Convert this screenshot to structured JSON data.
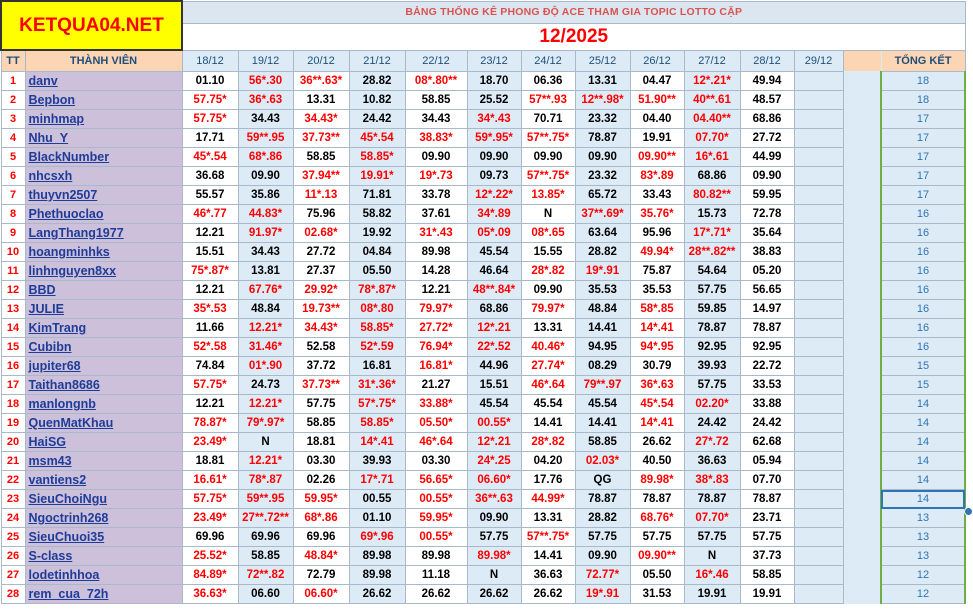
{
  "logo": "KETQUA04.NET",
  "banner_title": "BẢNG THỐNG KÊ PHONG ĐỘ ACE THAM GIA TOPIC  LOTTO CẶP",
  "banner_month": "12/2025",
  "headers": {
    "tt": "TT",
    "member": "THÀNH VIÊN",
    "dates": [
      "18/12",
      "19/12",
      "20/12",
      "21/12",
      "22/12",
      "23/12",
      "24/12",
      "25/12",
      "26/12",
      "27/12",
      "28/12",
      "29/12"
    ],
    "total": "TỔNG KẾT"
  },
  "rows": [
    {
      "tt": "1",
      "name": "danv",
      "total": "18",
      "cells": [
        "01.10",
        "56*.30",
        "36**.63*",
        "28.82",
        "08*.80**",
        "18.70",
        "06.36",
        "13.31",
        "04.47",
        "12*.21*",
        "49.94",
        ""
      ]
    },
    {
      "tt": "2",
      "name": "Bepbon",
      "total": "18",
      "cells": [
        "57.75*",
        "36*.63",
        "13.31",
        "10.82",
        "58.85",
        "25.52",
        "57**.93",
        "12**.98*",
        "51.90**",
        "40**.61",
        "48.57",
        ""
      ]
    },
    {
      "tt": "3",
      "name": "minhmap",
      "total": "17",
      "cells": [
        "57.75*",
        "34.43",
        "34.43*",
        "24.42",
        "34.43",
        "34*.43",
        "70.71",
        "23.32",
        "04.40",
        "04.40**",
        "68.86",
        ""
      ]
    },
    {
      "tt": "4",
      "name": "Nhu_Y",
      "total": "17",
      "cells": [
        "17.71",
        "59**.95",
        "37.73**",
        "45*.54",
        "38.83*",
        "59*.95*",
        "57**.75*",
        "78.87",
        "19.91",
        "07.70*",
        "27.72",
        ""
      ]
    },
    {
      "tt": "5",
      "name": "BlackNumber",
      "total": "17",
      "cells": [
        "45*.54",
        "68*.86",
        "58.85",
        "58.85*",
        "09.90",
        "09.90",
        "09.90",
        "09.90",
        "09.90**",
        "16*.61",
        "44.99",
        ""
      ]
    },
    {
      "tt": "6",
      "name": "nhcsxh",
      "total": "17",
      "cells": [
        "36.68",
        "09.90",
        "37.94**",
        "19.91*",
        "19*.73",
        "09.73",
        "57**.75*",
        "23.32",
        "83*.89",
        "68.86",
        "09.90",
        ""
      ]
    },
    {
      "tt": "7",
      "name": "thuyvn2507",
      "total": "17",
      "cells": [
        "55.57",
        "35.86",
        "11*.13",
        "71.81",
        "33.78",
        "12*.22*",
        "13.85*",
        "65.72",
        "33.43",
        "80.82**",
        "59.95",
        ""
      ]
    },
    {
      "tt": "8",
      "name": "Phethuoclao",
      "total": "16",
      "cells": [
        "46*.77",
        "44.83*",
        "75.96",
        "58.82",
        "37.61",
        "34*.89",
        "N",
        "37**.69*",
        "35.76*",
        "15.73",
        "72.78",
        ""
      ]
    },
    {
      "tt": "9",
      "name": "LangThang1977",
      "total": "16",
      "cells": [
        "12.21",
        "91.97*",
        "02.68*",
        "19.92",
        "31*.43",
        "05*.09",
        "08*.65",
        "63.64",
        "95.96",
        "17*.71*",
        "35.64",
        ""
      ]
    },
    {
      "tt": "10",
      "name": "hoangminhks",
      "total": "16",
      "cells": [
        "15.51",
        "34.43",
        "27.72",
        "04.84",
        "89.98",
        "45.54",
        "15.55",
        "28.82",
        "49.94*",
        "28**.82**",
        "38.83",
        ""
      ]
    },
    {
      "tt": "11",
      "name": "linhnguyen8xx",
      "total": "16",
      "cells": [
        "75*.87*",
        "13.81",
        "27.37",
        "05.50",
        "14.28",
        "46.64",
        "28*.82",
        "19*.91",
        "75.87",
        "54.64",
        "05.20",
        ""
      ]
    },
    {
      "tt": "12",
      "name": "BBD",
      "total": "16",
      "cells": [
        "12.21",
        "67.76*",
        "29.92*",
        "78*.87*",
        "12.21",
        "48**.84*",
        "09.90",
        "35.53",
        "35.53",
        "57.75",
        "56.65",
        ""
      ]
    },
    {
      "tt": "13",
      "name": "JULIE",
      "total": "16",
      "cells": [
        "35*.53",
        "48.84",
        "19.73**",
        "08*.80",
        "79.97*",
        "68.86",
        "79.97*",
        "48.84",
        "58*.85",
        "59.85",
        "14.97",
        ""
      ]
    },
    {
      "tt": "14",
      "name": "KimTrang",
      "total": "16",
      "cells": [
        "11.66",
        "12.21*",
        "34.43*",
        "58.85*",
        "27.72*",
        "12*.21",
        "13.31",
        "14.41",
        "14*.41",
        "78.87",
        "78.87",
        ""
      ]
    },
    {
      "tt": "15",
      "name": "Cubibn",
      "total": "16",
      "cells": [
        "52*.58",
        "31.46*",
        "52.58",
        "52*.59",
        "76.94*",
        "22*.52",
        "40.46*",
        "94.95",
        "94*.95",
        "92.95",
        "92.95",
        ""
      ]
    },
    {
      "tt": "16",
      "name": "jupiter68",
      "total": "15",
      "cells": [
        "74.84",
        "01*.90",
        "37.72",
        "16.81",
        "16.81*",
        "44.96",
        "27.74*",
        "08.29",
        "30.79",
        "39.93",
        "22.72",
        ""
      ]
    },
    {
      "tt": "17",
      "name": "Taithan8686",
      "total": "15",
      "cells": [
        "57.75*",
        "24.73",
        "37.73**",
        "31*.36*",
        "21.27",
        "15.51",
        "46*.64",
        "79**.97",
        "36*.63",
        "57.75",
        "33.53",
        ""
      ]
    },
    {
      "tt": "18",
      "name": "manlongnb",
      "total": "14",
      "cells": [
        "12.21",
        "12.21*",
        "57.75",
        "57*.75*",
        "33.88*",
        "45.54",
        "45.54",
        "45.54",
        "45*.54",
        "02.20*",
        "33.88",
        ""
      ]
    },
    {
      "tt": "19",
      "name": "QuenMatKhau",
      "total": "14",
      "cells": [
        "78.87*",
        "79*.97*",
        "58.85",
        "58.85*",
        "05.50*",
        "00.55*",
        "14.41",
        "14.41",
        "14*.41",
        "24.42",
        "24.42",
        ""
      ]
    },
    {
      "tt": "20",
      "name": "HaiSG",
      "total": "14",
      "cells": [
        "23.49*",
        "N",
        "18.81",
        "14*.41",
        "46*.64",
        "12*.21",
        "28*.82",
        "58.85",
        "26.62",
        "27*.72",
        "62.68",
        ""
      ]
    },
    {
      "tt": "21",
      "name": "msm43",
      "total": "14",
      "cells": [
        "18.81",
        "12.21*",
        "03.30",
        "39.93",
        "03.30",
        "24*.25",
        "04.20",
        "02.03*",
        "40.50",
        "36.63",
        "05.94",
        ""
      ]
    },
    {
      "tt": "22",
      "name": "vantiens2",
      "total": "14",
      "cells": [
        "16.61*",
        "78*.87",
        "02.26",
        "17*.71",
        "56.65*",
        "06.60*",
        "17.76",
        "QG",
        "89.98*",
        "38*.83",
        "07.70",
        ""
      ]
    },
    {
      "tt": "23",
      "name": "SieuChoiNgu",
      "total": "14",
      "cells": [
        "57.75*",
        "59**.95",
        "59.95*",
        "00.55",
        "00.55*",
        "36**.63",
        "44.99*",
        "78.87",
        "78.87",
        "78.87",
        "78.87",
        ""
      ]
    },
    {
      "tt": "24",
      "name": "Ngoctrinh268",
      "total": "13",
      "cells": [
        "23.49*",
        "27**.72**",
        "68*.86",
        "01.10",
        "59.95*",
        "09.90",
        "13.31",
        "28.82",
        "68.76*",
        "07.70*",
        "23.71",
        ""
      ]
    },
    {
      "tt": "25",
      "name": "SieuChuoi35",
      "total": "13",
      "cells": [
        "69.96",
        "69.96",
        "69.96",
        "69*.96",
        "00.55*",
        "57.75",
        "57**.75*",
        "57.75",
        "57.75",
        "57.75",
        "57.75",
        ""
      ]
    },
    {
      "tt": "26",
      "name": "S-class",
      "total": "13",
      "cells": [
        "25.52*",
        "58.85",
        "48.84*",
        "89.98",
        "89.98",
        "89.98*",
        "14.41",
        "09.90",
        "09.90**",
        "N",
        "37.73",
        ""
      ]
    },
    {
      "tt": "27",
      "name": "lodetinhhoa",
      "total": "12",
      "cells": [
        "84.89*",
        "72**.82",
        "72.79",
        "89.98",
        "11.18",
        "N",
        "36.63",
        "72.77*",
        "05.50",
        "16*.46",
        "58.85",
        ""
      ]
    },
    {
      "tt": "28",
      "name": "rem_cua_72h",
      "total": "12",
      "cells": [
        "36.63*",
        "06.60",
        "06.60*",
        "26.62",
        "26.62",
        "26.62",
        "26.62",
        "19*.91",
        "31.53",
        "19.91",
        "19.91",
        ""
      ]
    }
  ],
  "colors": {
    "win": "#ff0000",
    "normal": "#000000",
    "name": "#1f3c99",
    "logo_bg": "#ffff00",
    "header_bg": "#fcd5b4"
  }
}
